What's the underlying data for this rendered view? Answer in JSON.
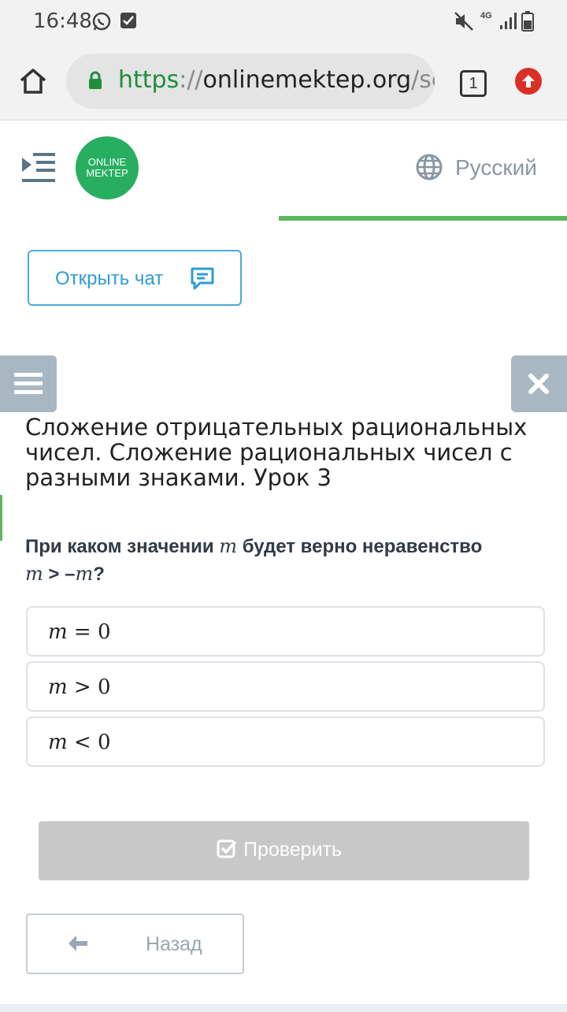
{
  "status_bar": {
    "time": "16:48",
    "network": "4G"
  },
  "browser": {
    "url_scheme": "https",
    "url_separator": "://",
    "url_host": "onlinemektep.org",
    "url_path": "/sc",
    "tab_count": "1"
  },
  "header": {
    "logo_line1": "ONLINE",
    "logo_line2": "MEKTEP",
    "language": "Русский"
  },
  "chat_button": {
    "label": "Открыть чат"
  },
  "lesson": {
    "title": "Сложение отрицательных рациональных чисел. Сложение рациональных чисел с разными знаками. Урок 3",
    "question_part1": "При каком значении ",
    "question_var": "m",
    "question_part2": " будет верно неравенство ",
    "question_expr_var1": "m",
    "question_expr_op": " > –",
    "question_expr_var2": "m",
    "question_end": "?"
  },
  "options": [
    {
      "var": "m",
      "rest": " = 0"
    },
    {
      "var": "m",
      "rest": " > 0"
    },
    {
      "var": "m",
      "rest": " < 0"
    }
  ],
  "check_button": {
    "label": "Проверить"
  },
  "back_button": {
    "label": "Назад"
  },
  "colors": {
    "accent_green": "#5cb85c",
    "logo_green": "#27ae60",
    "chat_blue": "#2e9cd6",
    "update_red": "#d93025"
  }
}
